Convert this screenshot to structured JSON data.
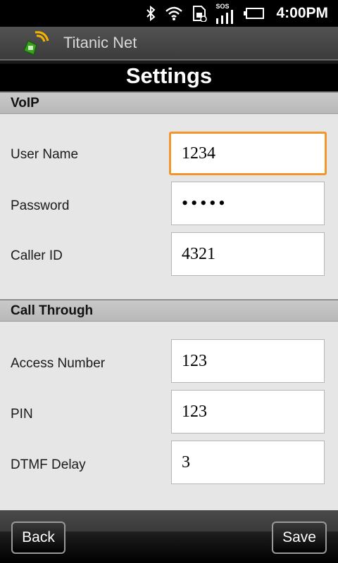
{
  "status_bar": {
    "time": "4:00PM",
    "sos_label": "SOS",
    "icons": [
      "bluetooth-icon",
      "wifi-icon",
      "sim-icon",
      "signal-icon",
      "battery-icon"
    ]
  },
  "app": {
    "title": "Titanic Net"
  },
  "screen": {
    "title": "Settings"
  },
  "sections": {
    "voip": {
      "title": "VoIP",
      "user_name": {
        "label": "User Name",
        "value": "1234"
      },
      "password": {
        "label": "Password",
        "value": "•••••"
      },
      "caller_id": {
        "label": "Caller ID",
        "value": "4321"
      }
    },
    "call_through": {
      "title": "Call Through",
      "access_number": {
        "label": "Access Number",
        "value": "123"
      },
      "pin": {
        "label": "PIN",
        "value": "123"
      },
      "dtmf_delay": {
        "label": "DTMF Delay",
        "value": "3"
      }
    }
  },
  "buttons": {
    "back": "Back",
    "save": "Save"
  },
  "colors": {
    "focus_border": "#f0962a",
    "section_bg": "#c4c4c4",
    "page_bg": "#e6e6e6"
  }
}
